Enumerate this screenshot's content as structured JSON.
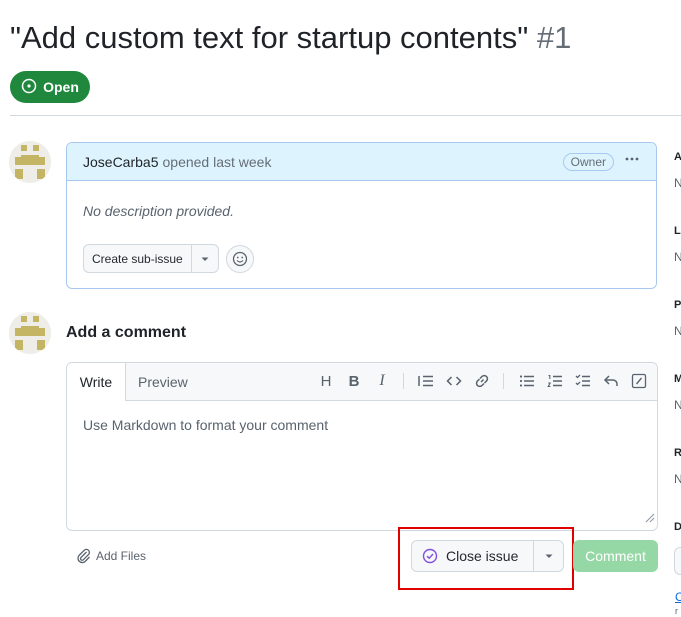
{
  "issue": {
    "title": "\"Add custom text for startup contents\"",
    "number": "#1",
    "state": "Open"
  },
  "comment": {
    "author": "JoseCarba5",
    "action": "opened last week",
    "role": "Owner",
    "body": "No description provided.",
    "create_sub_issue": "Create sub-issue"
  },
  "new_comment": {
    "heading": "Add a comment",
    "tab_write": "Write",
    "tab_preview": "Preview",
    "placeholder": "Use Markdown to format your comment",
    "add_files": "Add Files",
    "close_issue": "Close issue",
    "submit": "Comment"
  },
  "toolbar": {
    "heading": "H",
    "bold": "B",
    "italic": "I"
  },
  "sidebar_cut": {
    "letters": [
      "A",
      "L",
      "P",
      "M",
      "R",
      "D"
    ],
    "none_text": "N",
    "link_text": "C",
    "link_sub": "r"
  },
  "colors": {
    "open_green": "#1f883d",
    "highlight_red": "#e00000",
    "comment_header_bg": "#ddf4ff",
    "submit_disabled": "#95d8a6"
  }
}
